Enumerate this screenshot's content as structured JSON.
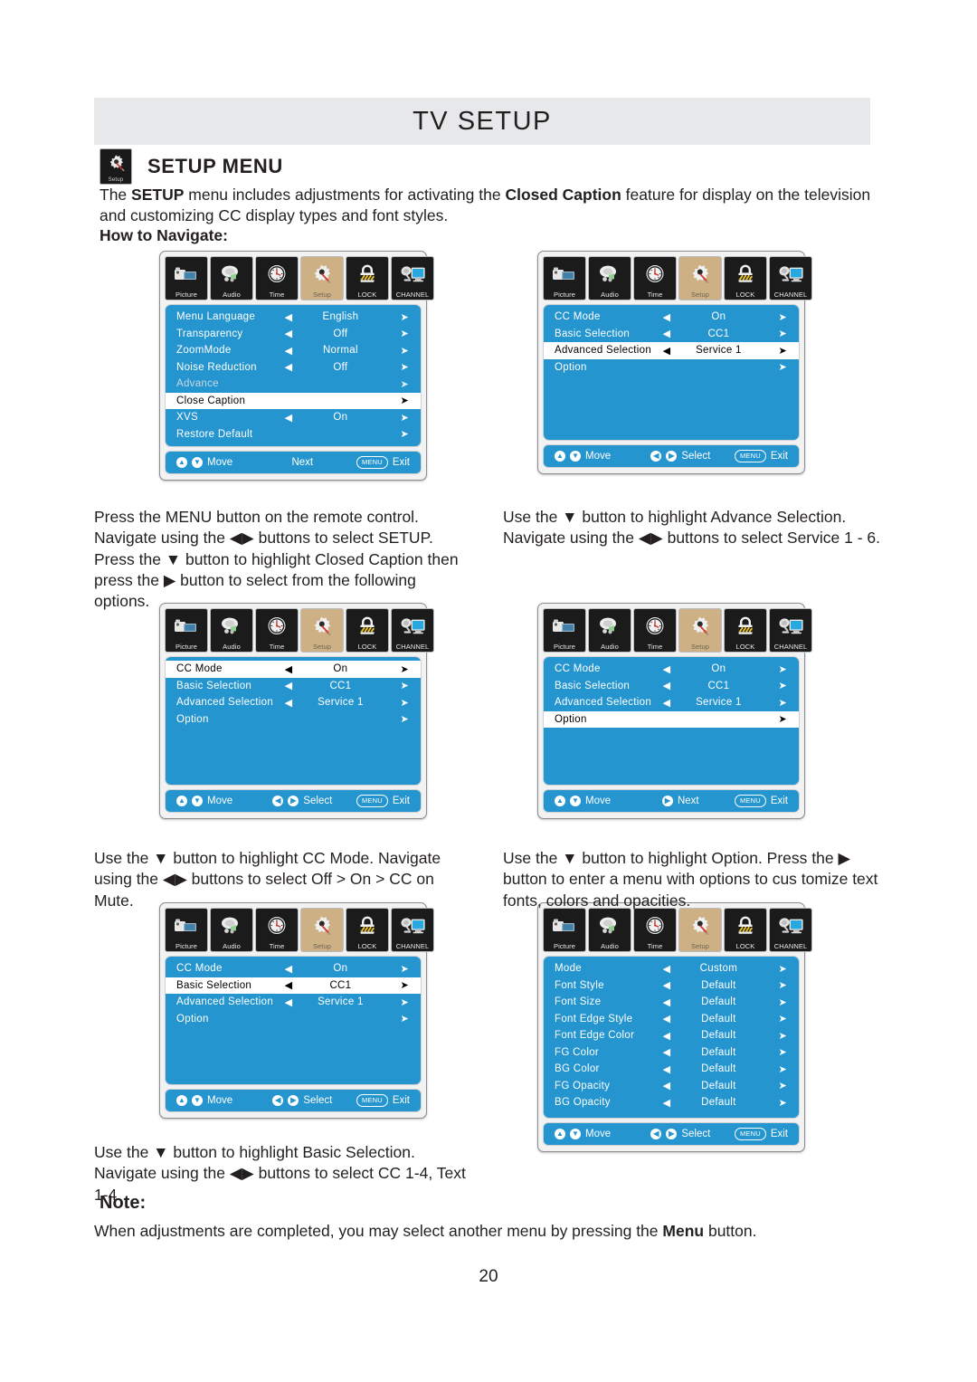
{
  "header": {
    "title": "TV SETUP"
  },
  "section": {
    "heading": "SETUP MENU",
    "heading_icon_label": "Setup",
    "intro_plain_1": "The ",
    "intro_bold_1": "SETUP",
    "intro_plain_2": " menu includes adjustments for activating the ",
    "intro_bold_2": "Closed Caption",
    "intro_plain_3": " feature for display on the television and customizing CC display types and font styles.",
    "how_to_navigate": "How to Navigate:"
  },
  "captions": {
    "left_1": "Press the MENU button on the remote control. Navigate using the ◀▶ buttons to select SETUP. Press the ▼ button to highlight Closed Caption then press the ▶ button to select from the following options.",
    "right_1": "Use the ▼ button to highlight Advance Selection. Navigate using the ◀▶ buttons to select Service 1 - 6.",
    "left_2": "Use the ▼ button to highlight CC Mode. Navigate using the ◀▶ buttons to select Off > On > CC on Mute.",
    "right_2": "Use the ▼ button to highlight Option. Press the ▶ button to enter a menu with options to cus tomize text fonts, colors and opacities.",
    "left_3": "Use the ▼ button to highlight Basic Selection. Navigate using the ◀▶ buttons to select CC 1-4, Text 1-4."
  },
  "note": {
    "title": "Note:",
    "body_plain_1": "When adjustments are completed, you may select another menu by pressing the ",
    "body_bold": "Menu",
    "body_plain_2": " button."
  },
  "page_number": "20",
  "colors": {
    "osd_blue": "#2595cf",
    "tab_active": "#cdb184",
    "tab_dark": "#1b1b1b",
    "header_band": "#e6e8e9",
    "text": "#231f20"
  },
  "tabs": [
    {
      "name": "picture-tab",
      "label": "Picture",
      "icon": "camcorder-icon",
      "active": false
    },
    {
      "name": "audio-tab",
      "label": "Audio",
      "icon": "speaker-note-icon",
      "active": false
    },
    {
      "name": "time-tab",
      "label": "Time",
      "icon": "clock-icon",
      "active": false
    },
    {
      "name": "setup-tab",
      "label": "Setup",
      "icon": "gear-screwdriver-icon",
      "active": true
    },
    {
      "name": "lock-tab",
      "label": "LOCK",
      "icon": "padlock-icon",
      "active": false
    },
    {
      "name": "channel-tab",
      "label": "CHANNEL",
      "icon": "monitor-antenna-icon",
      "active": false
    }
  ],
  "arrows": {
    "left": "◀",
    "right": "➤"
  },
  "panels": {
    "setup": {
      "name": "setup-menu-panel",
      "rows": [
        {
          "label": "Menu Language",
          "value": "English",
          "left": "◀",
          "right": "➤",
          "state": "normal"
        },
        {
          "label": "Transparency",
          "value": "Off",
          "left": "◀",
          "right": "➤",
          "state": "normal"
        },
        {
          "label": "ZoomMode",
          "value": "Normal",
          "left": "◀",
          "right": "➤",
          "state": "normal"
        },
        {
          "label": "Noise Reduction",
          "value": "Off",
          "left": "◀",
          "right": "➤",
          "state": "normal"
        },
        {
          "label": "Advance",
          "value": "",
          "left": "",
          "right": "➤",
          "state": "dim"
        },
        {
          "label": "Close Caption",
          "value": "",
          "left": "",
          "right": "➤",
          "state": "selected"
        },
        {
          "label": "XVS",
          "value": "On",
          "left": "◀",
          "right": "➤",
          "state": "normal"
        },
        {
          "label": "Restore Default",
          "value": "",
          "left": "",
          "right": "➤",
          "state": "normal"
        }
      ],
      "footer": {
        "move": "Move",
        "mid": "Next",
        "mid_icon": "none",
        "exit": "Exit",
        "menu_pill": "MENU"
      }
    },
    "cc_advanced": {
      "name": "cc-advanced-selection-panel",
      "rows": [
        {
          "label": "CC Mode",
          "value": "On",
          "left": "◀",
          "right": "➤",
          "state": "normal"
        },
        {
          "label": "Basic Selection",
          "value": "CC1",
          "left": "◀",
          "right": "➤",
          "state": "normal"
        },
        {
          "label": "Advanced Selection",
          "value": "Service 1",
          "left": "◀",
          "right": "➤",
          "state": "selected"
        },
        {
          "label": "Option",
          "value": "",
          "left": "",
          "right": "➤",
          "state": "normal"
        }
      ],
      "footer": {
        "move": "Move",
        "mid": "Select",
        "mid_icon": "lr",
        "exit": "Exit",
        "menu_pill": "MENU"
      }
    },
    "cc_mode": {
      "name": "cc-mode-panel",
      "rows": [
        {
          "label": "CC Mode",
          "value": "On",
          "left": "◀",
          "right": "➤",
          "state": "selected"
        },
        {
          "label": "Basic Selection",
          "value": "CC1",
          "left": "◀",
          "right": "➤",
          "state": "normal"
        },
        {
          "label": "Advanced Selection",
          "value": "Service 1",
          "left": "◀",
          "right": "➤",
          "state": "normal"
        },
        {
          "label": "Option",
          "value": "",
          "left": "",
          "right": "➤",
          "state": "normal"
        }
      ],
      "footer": {
        "move": "Move",
        "mid": "Select",
        "mid_icon": "lr",
        "exit": "Exit",
        "menu_pill": "MENU"
      }
    },
    "cc_option": {
      "name": "cc-option-panel",
      "rows": [
        {
          "label": "CC Mode",
          "value": "On",
          "left": "◀",
          "right": "➤",
          "state": "normal"
        },
        {
          "label": "Basic Selection",
          "value": "CC1",
          "left": "◀",
          "right": "➤",
          "state": "normal"
        },
        {
          "label": "Advanced Selection",
          "value": "Service 1",
          "left": "◀",
          "right": "➤",
          "state": "normal"
        },
        {
          "label": "Option",
          "value": "",
          "left": "",
          "right": "➤",
          "state": "selected"
        }
      ],
      "footer": {
        "move": "Move",
        "mid": "Next",
        "mid_icon": "r",
        "exit": "Exit",
        "menu_pill": "MENU"
      }
    },
    "cc_basic": {
      "name": "cc-basic-selection-panel",
      "rows": [
        {
          "label": "CC Mode",
          "value": "On",
          "left": "◀",
          "right": "➤",
          "state": "normal"
        },
        {
          "label": "Basic Selection",
          "value": "CC1",
          "left": "◀",
          "right": "➤",
          "state": "selected"
        },
        {
          "label": "Advanced Selection",
          "value": "Service 1",
          "left": "◀",
          "right": "➤",
          "state": "normal"
        },
        {
          "label": "Option",
          "value": "",
          "left": "",
          "right": "➤",
          "state": "normal"
        }
      ],
      "footer": {
        "move": "Move",
        "mid": "Select",
        "mid_icon": "lr",
        "exit": "Exit",
        "menu_pill": "MENU"
      }
    },
    "options": {
      "name": "cc-options-customize-panel",
      "rows": [
        {
          "label": "Mode",
          "value": "Custom",
          "left": "◀",
          "right": "➤",
          "state": "normal"
        },
        {
          "label": "Font Style",
          "value": "Default",
          "left": "◀",
          "right": "➤",
          "state": "normal"
        },
        {
          "label": "Font Size",
          "value": "Default",
          "left": "◀",
          "right": "➤",
          "state": "normal"
        },
        {
          "label": "Font Edge Style",
          "value": "Default",
          "left": "◀",
          "right": "➤",
          "state": "normal"
        },
        {
          "label": "Font Edge Color",
          "value": "Default",
          "left": "◀",
          "right": "➤",
          "state": "normal"
        },
        {
          "label": "FG Color",
          "value": "Default",
          "left": "◀",
          "right": "➤",
          "state": "normal"
        },
        {
          "label": "BG Color",
          "value": "Default",
          "left": "◀",
          "right": "➤",
          "state": "normal"
        },
        {
          "label": "FG Opacity",
          "value": "Default",
          "left": "◀",
          "right": "➤",
          "state": "normal"
        },
        {
          "label": "BG Opacity",
          "value": "Default",
          "left": "◀",
          "right": "➤",
          "state": "normal"
        }
      ],
      "footer": {
        "move": "Move",
        "mid": "Select",
        "mid_icon": "lr",
        "exit": "Exit",
        "menu_pill": "MENU"
      }
    }
  }
}
